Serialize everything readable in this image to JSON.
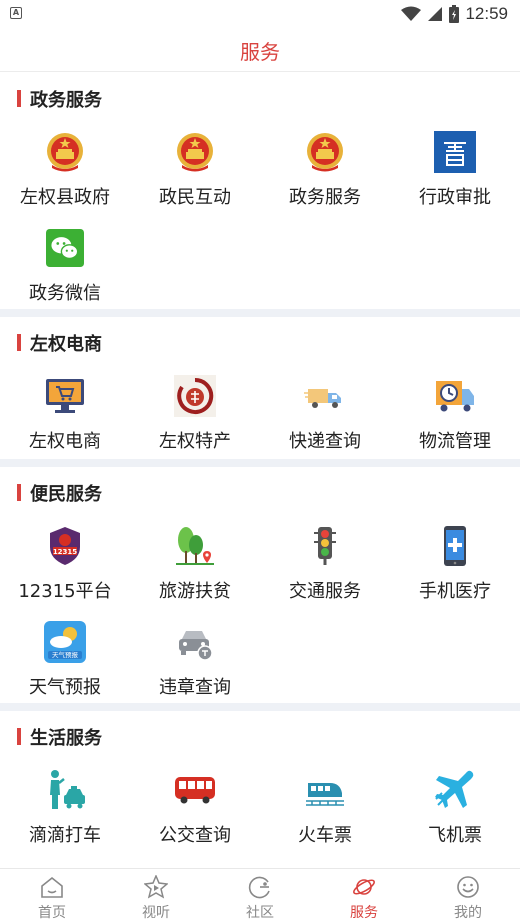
{
  "status": {
    "time": "12:59"
  },
  "header": {
    "title": "服务"
  },
  "sections": [
    {
      "title": "政务服务",
      "items": [
        "左权县政府",
        "政民互动",
        "政务服务",
        "行政审批",
        "政务微信"
      ]
    },
    {
      "title": "左权电商",
      "items": [
        "左权电商",
        "左权特产",
        "快递查询",
        "物流管理"
      ]
    },
    {
      "title": "便民服务",
      "items": [
        "12315平台",
        "旅游扶贫",
        "交通服务",
        "手机医疗",
        "天气预报",
        "违章查询"
      ]
    },
    {
      "title": "生活服务",
      "items": [
        "滴滴打车",
        "公交查询",
        "火车票",
        "飞机票"
      ]
    }
  ],
  "icon_badges": {
    "c12315": "12315",
    "weather": "天气预报"
  },
  "tabs": [
    {
      "label": "首页"
    },
    {
      "label": "视听"
    },
    {
      "label": "社区"
    },
    {
      "label": "服务"
    },
    {
      "label": "我的"
    }
  ],
  "colors": {
    "accent": "#d9433f",
    "divider": "#eef1f6"
  }
}
